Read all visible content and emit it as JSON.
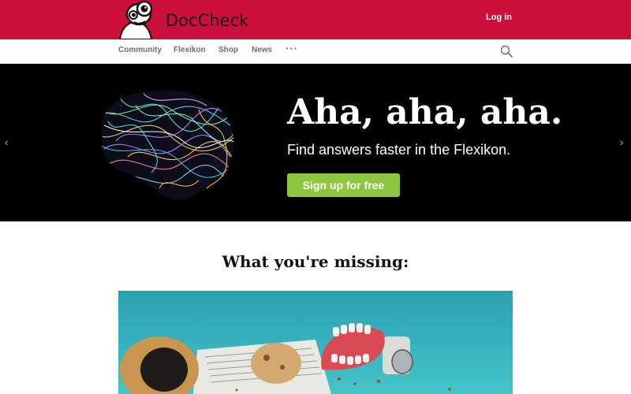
{
  "header": {
    "brand_name": "DocCheck",
    "login_label": "Log in",
    "color": "#cc0e3b"
  },
  "nav": {
    "items": [
      {
        "label": "Community"
      },
      {
        "label": "Flexikon"
      },
      {
        "label": "Shop"
      },
      {
        "label": "News"
      }
    ],
    "more_label": "···",
    "search_icon": "search-icon"
  },
  "hero": {
    "title": "Aha, aha, aha.",
    "subtitle": "Find answers faster in the Flexikon.",
    "cta_label": "Sign up for free",
    "cta_color": "#8dc63f",
    "prev_label": "‹",
    "next_label": "›"
  },
  "section": {
    "heading": "What you're missing:"
  }
}
